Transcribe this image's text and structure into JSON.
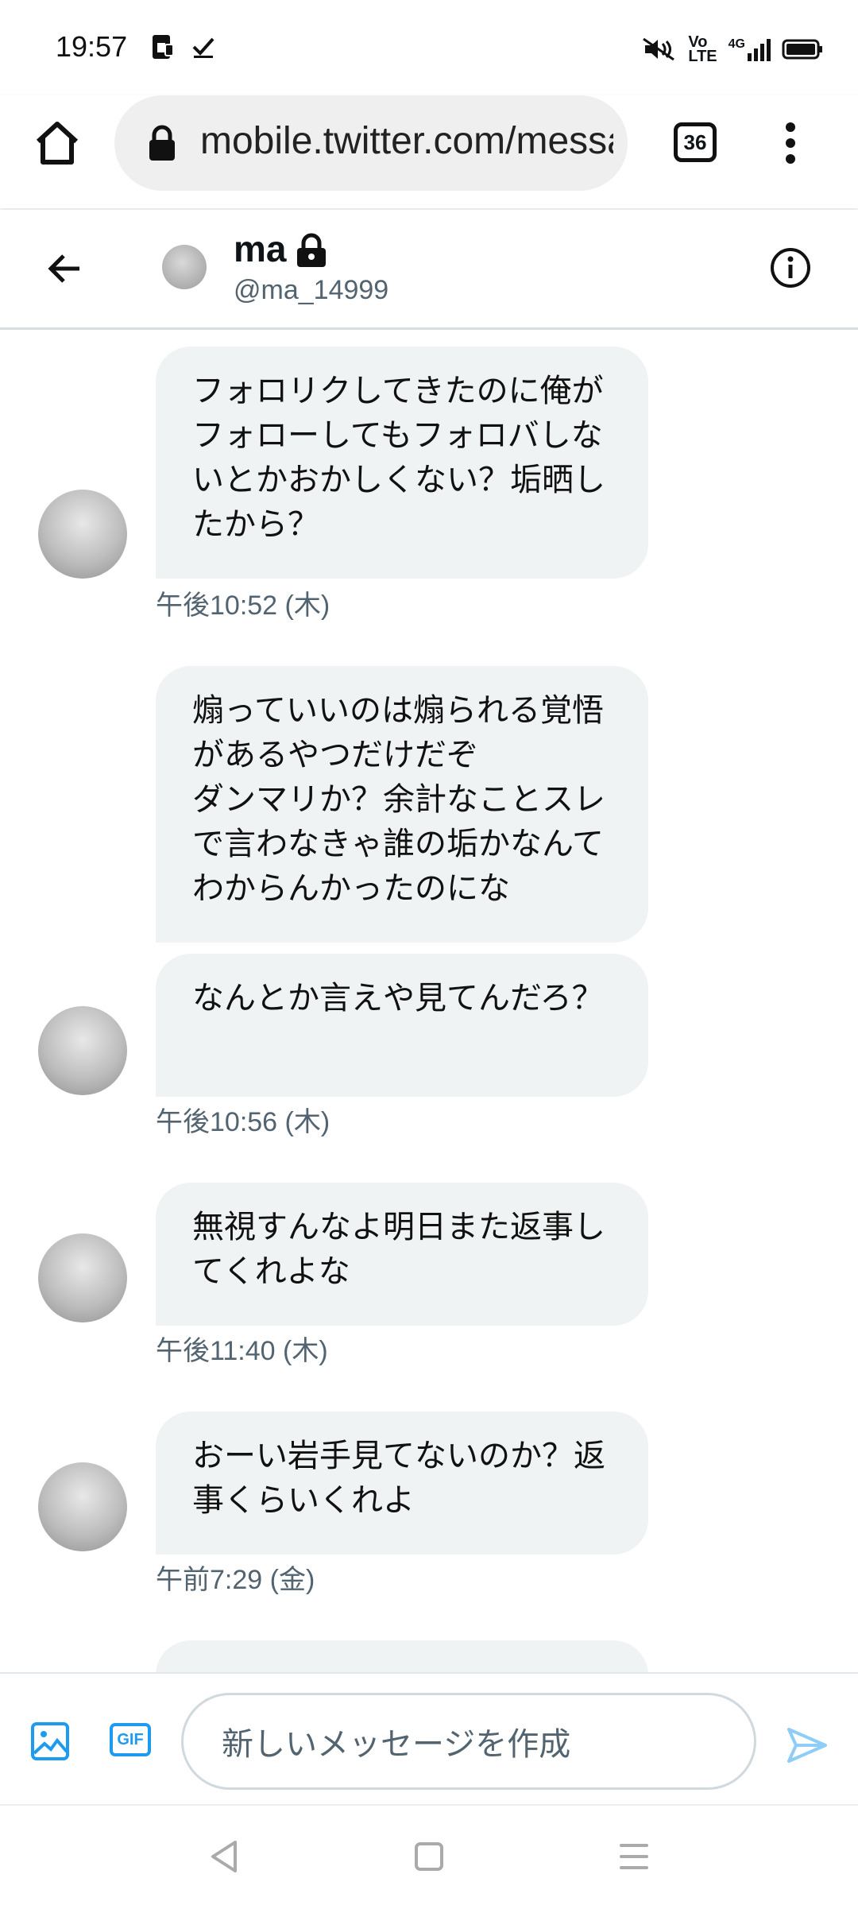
{
  "status_bar": {
    "time": "19:57",
    "left_icons": [
      "sim-card-icon",
      "checkmark-icon"
    ],
    "right_icons": [
      "mute-icon",
      "volte-icon",
      "signal-icon",
      "battery-icon"
    ],
    "volte_label": "Vo\nLTE",
    "network_label": "4G"
  },
  "browser": {
    "url": "mobile.twitter.com/messages",
    "tab_count": "36"
  },
  "conversation": {
    "name": "ma",
    "handle": "@ma_14999",
    "accent_color": "#1d9bf0"
  },
  "messages": [
    {
      "text": "フォロリクしてきたのに俺がフォローしてもフォロバしないとかおかしくない？垢晒したから？"
    },
    {
      "timestamp": "午後10:52 (木)"
    },
    {
      "text": "煽っていいのは煽られる覚悟があるやつだけだぞ\nダンマリか？余計なことスレで言わなきゃ誰の垢かなんてわからんかったのにな"
    },
    {
      "text": "なんとか言えや見てんだろ？"
    },
    {
      "timestamp": "午後10:56 (木)"
    },
    {
      "text": "無視すんなよ明日また返事してくれよな"
    },
    {
      "timestamp": "午後11:40 (木)"
    },
    {
      "text": "おーい岩手見てないのか？返事くらいくれよ"
    },
    {
      "timestamp": "午前7:29 (金)"
    }
  ],
  "composer": {
    "placeholder": "新しいメッセージを作成",
    "gif_label": "GIF"
  }
}
